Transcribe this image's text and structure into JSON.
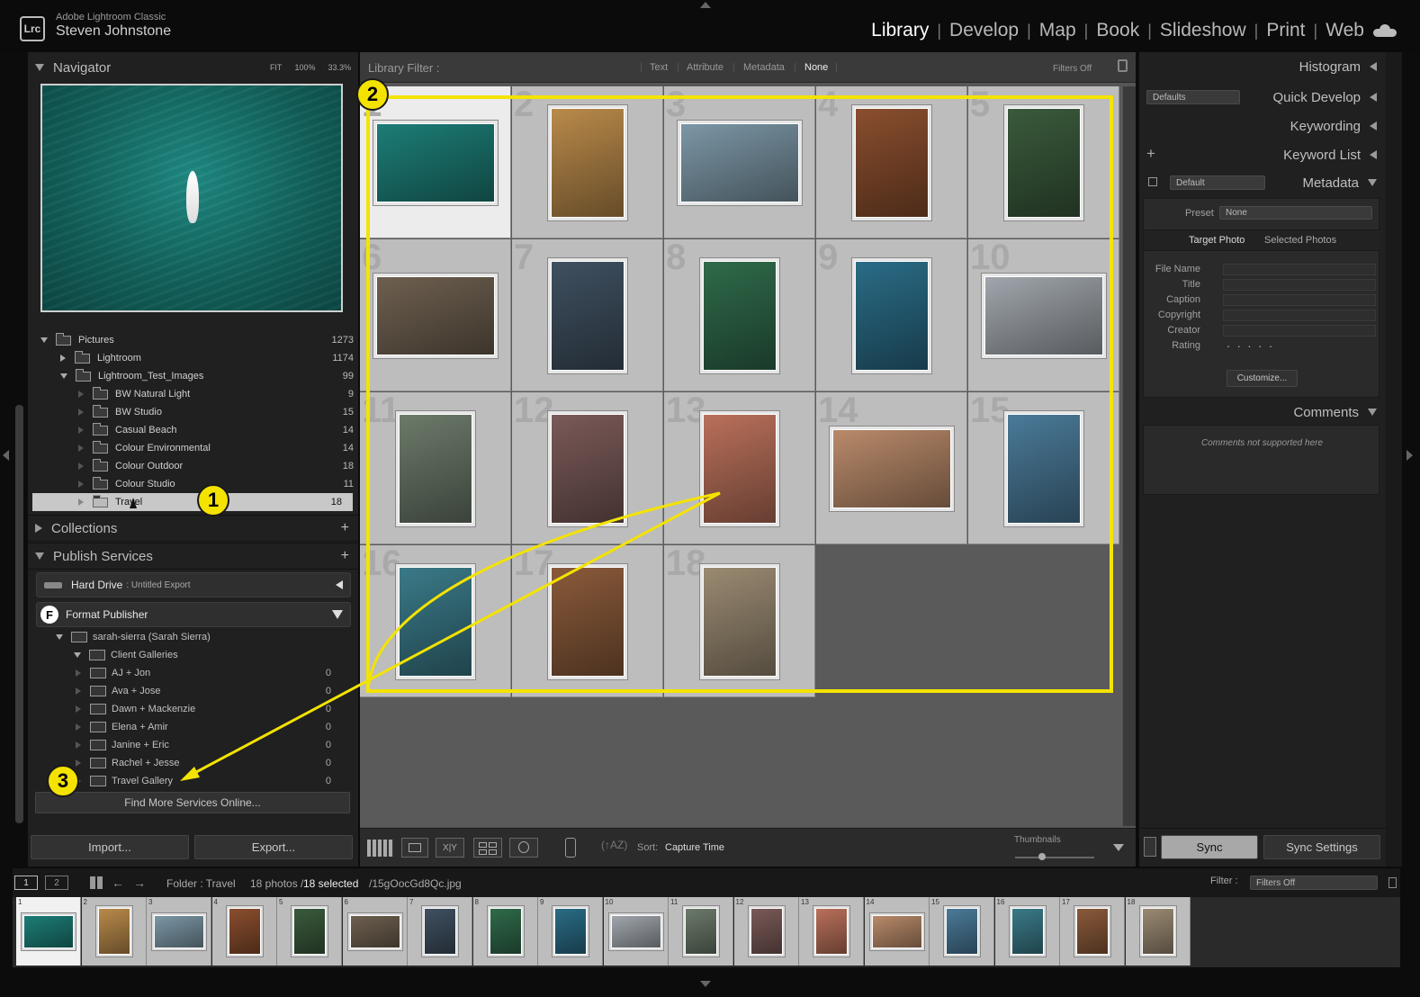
{
  "app": {
    "logo": "Lrc",
    "name": "Adobe Lightroom Classic",
    "user": "Steven Johnstone"
  },
  "modules": [
    {
      "label": "Library",
      "active": true
    },
    {
      "label": "Develop"
    },
    {
      "label": "Map"
    },
    {
      "label": "Book"
    },
    {
      "label": "Slideshow"
    },
    {
      "label": "Print"
    },
    {
      "label": "Web"
    }
  ],
  "navigator": {
    "title": "Navigator",
    "zoom_options": [
      "FIT",
      "100%",
      "33.3%"
    ]
  },
  "folders": {
    "rows": [
      {
        "label": "Pictures",
        "count": "1273"
      },
      {
        "label": "Lightroom",
        "count": "1174"
      },
      {
        "label": "Lightroom_Test_Images",
        "count": "99"
      },
      {
        "label": "BW Natural Light",
        "count": "9"
      },
      {
        "label": "BW Studio",
        "count": "15"
      },
      {
        "label": "Casual Beach",
        "count": "14"
      },
      {
        "label": "Colour Environmental",
        "count": "14"
      },
      {
        "label": "Colour Outdoor",
        "count": "18"
      },
      {
        "label": "Colour Studio",
        "count": "11"
      },
      {
        "label": "Travel",
        "count": "18"
      }
    ]
  },
  "collections": {
    "title": "Collections"
  },
  "publish": {
    "title": "Publish Services",
    "hard_drive": {
      "label": "Hard Drive",
      "sub": ": Untitled Export"
    },
    "format": {
      "logo": "F",
      "label": "Format Publisher"
    },
    "account": "sarah-sierra (Sarah Sierra)",
    "group": "Client Galleries",
    "galleries": [
      {
        "label": "AJ + Jon",
        "count": "0"
      },
      {
        "label": "Ava + Jose",
        "count": "0"
      },
      {
        "label": "Dawn + Mackenzie",
        "count": "0"
      },
      {
        "label": "Elena + Amir",
        "count": "0"
      },
      {
        "label": "Janine + Eric",
        "count": "0"
      },
      {
        "label": "Rachel + Jesse",
        "count": "0"
      },
      {
        "label": "Travel Gallery",
        "count": "0"
      }
    ],
    "find_more": "Find More Services Online..."
  },
  "buttons": {
    "import": "Import...",
    "export": "Export...",
    "sync": "Sync",
    "sync_settings": "Sync Settings"
  },
  "filter": {
    "label": "Library Filter :",
    "options": [
      "Text",
      "Attribute",
      "Metadata",
      "None"
    ],
    "active": "None",
    "filters_off": "Filters Off"
  },
  "grid": {
    "photos": [
      {
        "n": "1",
        "c": "#1d7d77"
      },
      {
        "n": "2",
        "c": "#b98a4a"
      },
      {
        "n": "3",
        "c": "#7c97a6"
      },
      {
        "n": "4",
        "c": "#8a4e2e"
      },
      {
        "n": "5",
        "c": "#3a5a3c"
      },
      {
        "n": "6",
        "c": "#6e6050"
      },
      {
        "n": "7",
        "c": "#3f5060"
      },
      {
        "n": "8",
        "c": "#2f6a4a"
      },
      {
        "n": "9",
        "c": "#2a6c86"
      },
      {
        "n": "10",
        "c": "#a0a6ac"
      },
      {
        "n": "11",
        "c": "#6c7a6a"
      },
      {
        "n": "12",
        "c": "#7a5a58"
      },
      {
        "n": "13",
        "c": "#b9705a"
      },
      {
        "n": "14",
        "c": "#b98a6a"
      },
      {
        "n": "15",
        "c": "#4a7a98"
      },
      {
        "n": "16",
        "c": "#3a7a88"
      },
      {
        "n": "17",
        "c": "#8a5a3a"
      },
      {
        "n": "18",
        "c": "#9a8a72"
      }
    ]
  },
  "toolbar": {
    "sort_label": "Sort:",
    "sort_value": "Capture Time",
    "thumbnails": "Thumbnails"
  },
  "right": {
    "histogram": "Histogram",
    "quick_develop": "Quick Develop",
    "qd_preset": "Defaults",
    "keywording": "Keywording",
    "keyword_list": "Keyword List",
    "metadata": "Metadata",
    "md_preset": "Default",
    "preset_label": "Preset",
    "preset_value": "None",
    "target_photo": "Target Photo",
    "selected_photos": "Selected Photos",
    "fields": [
      "File Name",
      "Title",
      "Caption",
      "Copyright",
      "Creator",
      "Rating"
    ],
    "rating_dots": ". . . . .",
    "customize": "Customize...",
    "comments": "Comments",
    "comments_note": "Comments not supported here"
  },
  "filmstrip": {
    "screen1": "1",
    "screen2": "2",
    "folder": "Folder : Travel",
    "photos": "18 photos /",
    "selected": "18 selected",
    "file": "/15gOocGd8Qc.jpg",
    "filter_label": "Filter :",
    "filter_value": "Filters Off"
  },
  "annotations": {
    "b1": "1",
    "b2": "2",
    "b3": "3"
  }
}
